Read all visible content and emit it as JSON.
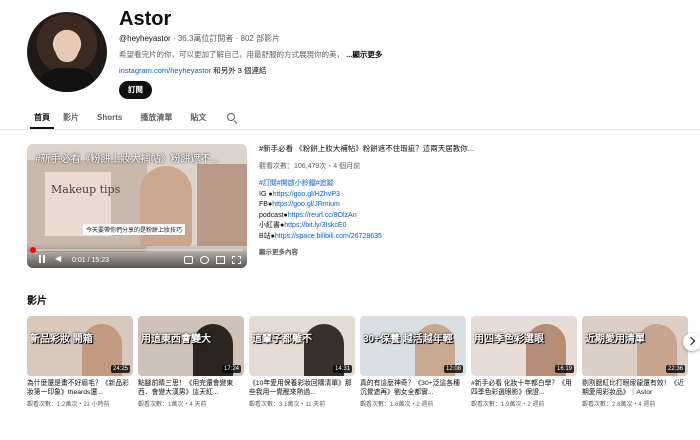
{
  "channel": {
    "name": "Astor",
    "handle": "@heyheyastor",
    "subscribers": "36.3萬位訂閱者",
    "video_count": "802 部影片",
    "description": "希望看完片的你，可以更加了解自己，用最舒服的方式展現你的美，",
    "more_label": "...顯示更多",
    "link": "instagram.com/heyheyastor",
    "link_extra": "和另外 3 個連結",
    "subscribe_label": "訂閱"
  },
  "tabs": [
    "首頁",
    "影片",
    "Shorts",
    "播放清單",
    "貼文"
  ],
  "featured": {
    "overlay_title": "#新手必看《粉餅上妝大補帖》粉餅遮不...",
    "card_text": "Makeup tips",
    "subtitle": "今天要帶你們分享的是粉餅上妝技巧",
    "time": "0:01 / 15:23",
    "progress": 0.001,
    "title": "#新手必看 《粉餅上妝大補帖》粉餅遮不住瑕疵？這兩天居教你...",
    "stats": "觀看次數：106,479次・4 個月前",
    "desc_lines": [
      {
        "label": "",
        "value": "#訂閱#開啟小鈴鐺#追蹤",
        "kind": "hash"
      },
      {
        "label": "IG ●",
        "value": "https://goo.gl/HZhvP3",
        "kind": "url"
      },
      {
        "label": "FB●",
        "value": "https://goo.gl/JRmium",
        "kind": "url"
      },
      {
        "label": "podcast●",
        "value": "https://reurl.cc/9OlzAn",
        "kind": "url"
      },
      {
        "label": "小紅書●",
        "value": "https://bit.ly/3IskcE0",
        "kind": "url"
      },
      {
        "label": "B站●",
        "value": "https://space.bilibili.com/26728635",
        "kind": "url"
      }
    ],
    "more_label": "顯示更多內容"
  },
  "shelf": {
    "title": "影片",
    "videos": [
      {
        "overlay": "新品彩妝 開箱",
        "duration": "24:25",
        "title": "為什麼還是畫不好眉毛？《新品彩妝第一印象》theards還...",
        "stats": "觀看次數：1.2萬次・21 小時前",
        "bg": "#d9c9bd",
        "fig": "#c19a7f"
      },
      {
        "overlay": "用這東西會變大",
        "duration": "17:24",
        "title": "點腳前睛三思！《用完還會變東西．會變大漢男》這天紅...",
        "stats": "觀看次數：1萬次・4 天前",
        "bg": "#cfc2b8",
        "fig": "#2b2522"
      },
      {
        "overlay": "這輩子都離不",
        "duration": "14:31",
        "title": "《10年愛用保養彩妝回購清單》那些我用一覺醒來熱過...",
        "stats": "觀看次數：3.1萬次・11 天前",
        "bg": "#e4dbd2",
        "fig": "#3a302b"
      },
      {
        "overlay": "30+保養 越活越年輕",
        "duration": "12:08",
        "title": "真的有這麼神奇？《30+泛這各種沉覺遮再》劉女全都實...",
        "stats": "觀看次數：1.6萬次・2 週前",
        "bg": "#d8e0e4",
        "fig": "#c9a890"
      },
      {
        "overlay": "用四季色彩選眼",
        "duration": "16:19",
        "title": "#新手必看 化妝十年都白學？《用四季色彩選眼影》保證...",
        "stats": "觀看次數：1.9萬次・2 週前",
        "bg": "#e7ddd6",
        "fig": "#b58d76"
      },
      {
        "overlay": "近期愛用清單",
        "duration": "22:36",
        "title": "剔割腮紅比打眼尿龍還有效！《近期愛用彩妝品》｜Astor",
        "stats": "觀看次數：2.8萬次・4 週前",
        "bg": "#dccfc6",
        "fig": "#c7a48d"
      }
    ]
  },
  "icons": [
    "search-icon",
    "pause-icon",
    "volume-icon",
    "cc-icon",
    "settings-icon",
    "miniplayer-icon",
    "fullscreen-icon",
    "chevron-right-icon"
  ],
  "colors": {
    "accent": "#065fd4",
    "subscribe_bg": "#0f0f0f",
    "progress": "#ff0000"
  }
}
